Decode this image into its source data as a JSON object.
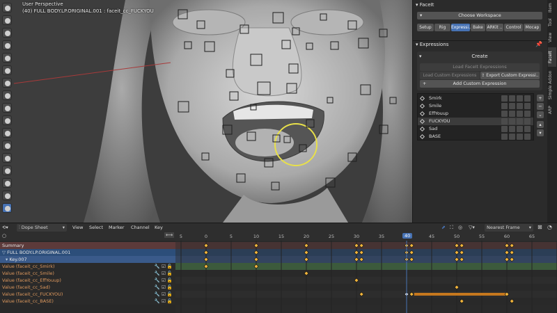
{
  "viewport": {
    "perspective_label": "User Perspective",
    "object_label": "(40) FULL BODY.LP.ORIGINAL.001 : faceit_cc_FUCKYOU"
  },
  "panel": {
    "title": "FaceIt",
    "workspace_button": "Choose Workspace",
    "workspace_tabs": [
      "Setup",
      "Rig",
      "Expressi..",
      "Bake",
      "ARKit ..",
      "Control",
      "Mocap"
    ],
    "active_tab_index": 2,
    "expressions_title": "Expressions",
    "create_label": "Create",
    "load_facs": "Load FaceIt Expressions",
    "load_custom": "Load Custom Expressions",
    "export_custom": "Export Custom Expressi..",
    "add_custom": "Add Custom Expression",
    "expressions": [
      "Smirk",
      "Smile",
      "EffYouup",
      "FUCKYOU",
      "Sad",
      "BASE"
    ],
    "selected_expression_index": 3,
    "side_tabs": [
      "Item",
      "Tool",
      "View",
      "FaceIt",
      "Simple Addon",
      "ARP"
    ]
  },
  "dopesheet": {
    "editor_mode": "Dope Sheet",
    "menus": [
      "View",
      "Select",
      "Marker",
      "Channel",
      "Key"
    ],
    "snap_mode": "Nearest Frame",
    "current_frame": "40",
    "ruler": [
      "5",
      "0",
      "5",
      "10",
      "15",
      "20",
      "25",
      "30",
      "35",
      "40",
      "45",
      "50",
      "55",
      "60",
      "65"
    ],
    "channels": [
      {
        "label": "Summary",
        "kind": "summary"
      },
      {
        "label": "FULL BODY.LP.ORIGINAL.001",
        "kind": "object"
      },
      {
        "label": "Key.007",
        "kind": "key"
      },
      {
        "label": "Value (faceit_cc_Smirk)",
        "kind": "value"
      },
      {
        "label": "Value (faceit_cc_Smile)",
        "kind": "value"
      },
      {
        "label": "Value (faceit_cc_EffYouup)",
        "kind": "value"
      },
      {
        "label": "Value (faceit_cc_Sad)",
        "kind": "value"
      },
      {
        "label": "Value (faceit_cc_FUCKYOU)",
        "kind": "value"
      },
      {
        "label": "Value (faceit_cc_BASE)",
        "kind": "value"
      }
    ]
  },
  "colors": {
    "accent": "#4772b3",
    "key_yellow": "#f0b43c",
    "value_text": "#e09a5e",
    "summary_row": "#5c3a3a",
    "object_row": "#2c4e7a",
    "key_row": "#3a5a8a",
    "smirk_bar": "#3c5a3c",
    "orange_hold": "#c6781e"
  }
}
